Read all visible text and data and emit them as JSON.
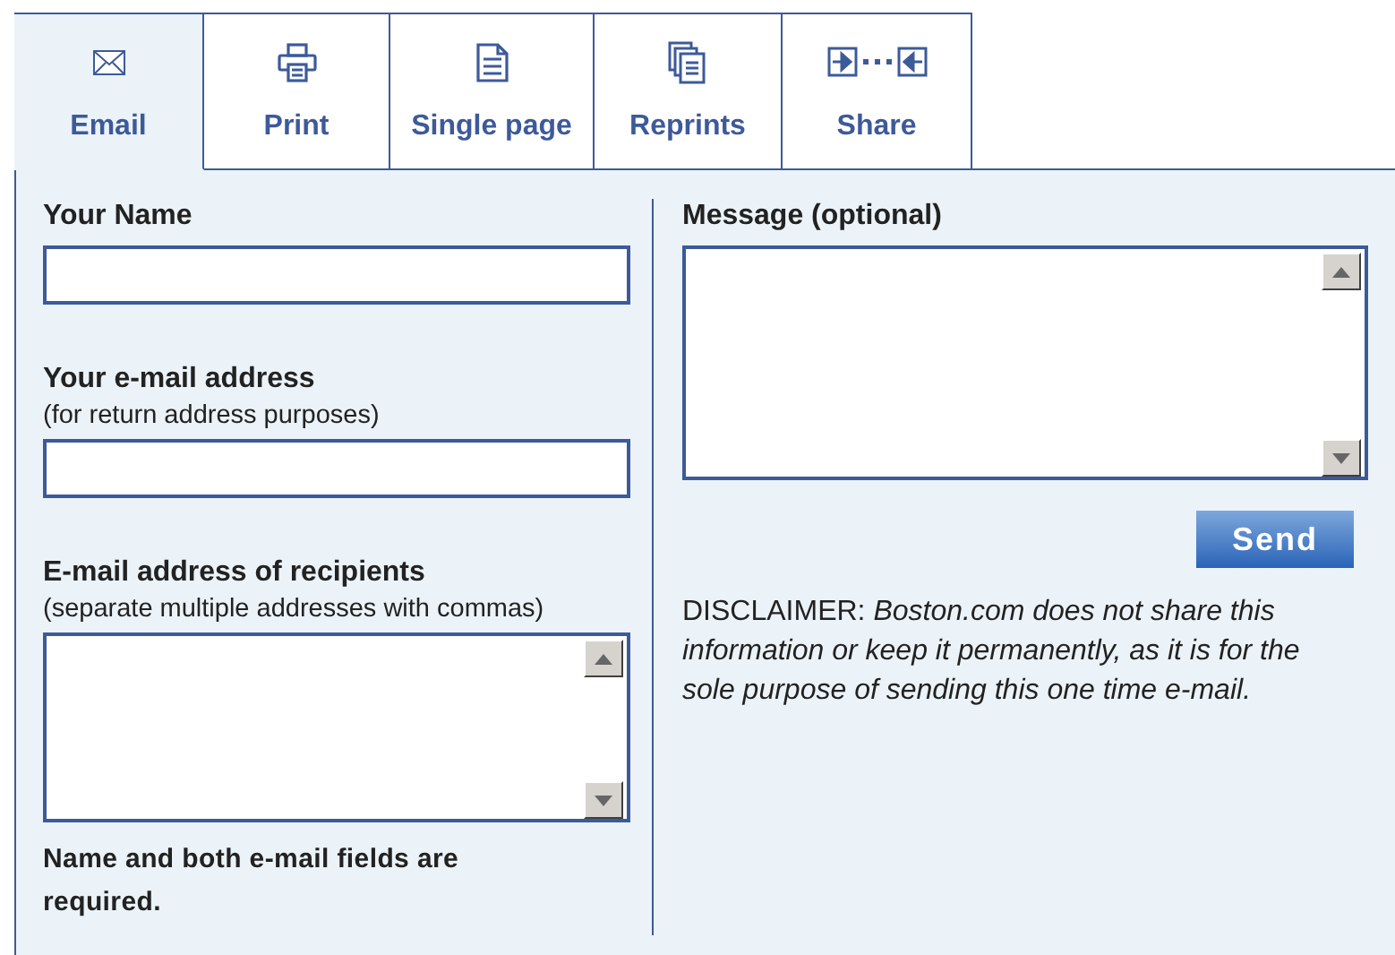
{
  "tabs": [
    {
      "label": "Email",
      "kind": "envelope",
      "selected": true
    },
    {
      "label": "Print",
      "kind": "printer",
      "selected": false
    },
    {
      "label": "Single page",
      "kind": "page",
      "selected": false
    },
    {
      "label": "Reprints",
      "kind": "pages",
      "selected": false
    },
    {
      "label": "Share",
      "kind": "share",
      "selected": false
    }
  ],
  "left_fields": [
    {
      "label": "Your Name",
      "kind": "input"
    },
    {
      "label": "Your e-mail address",
      "hint": "(for return address purposes)",
      "kind": "input"
    },
    {
      "label": "E-mail address of recipients",
      "hint": "(separate multiple addresses with commas)",
      "kind": "textarea"
    }
  ],
  "required_note": "Name and both e-mail fields are required.",
  "message_field": {
    "label": "Message (optional)",
    "kind": "textarea"
  },
  "send_button": "Send",
  "disclaimer": "DISCLAIMER: *Boston.com does not share this information or keep it permanently, as it is for the sole purpose of sending this one time e-mail.*"
}
